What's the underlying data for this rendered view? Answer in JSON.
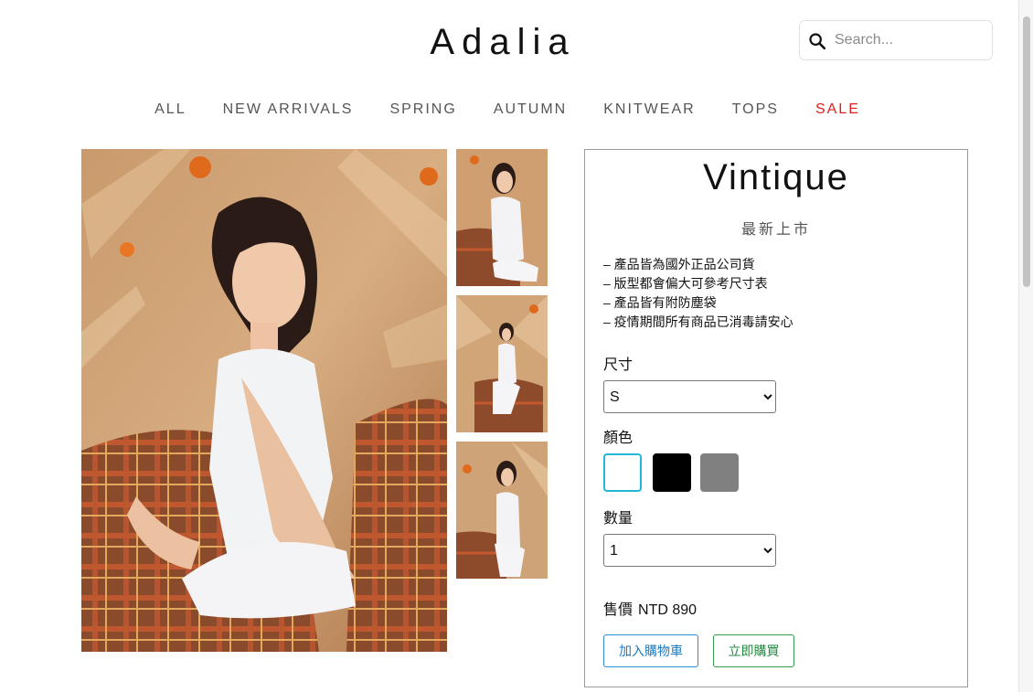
{
  "header": {
    "logo": "Adalia",
    "search": {
      "placeholder": "Search..."
    }
  },
  "nav": {
    "items": [
      "ALL",
      "NEW ARRIVALS",
      "SPRING",
      "AUTUMN",
      "KNITWEAR",
      "TOPS",
      "SALE"
    ],
    "highlight_color": "#e02020"
  },
  "product": {
    "brand": "Vintique",
    "subtitle": "最新上市",
    "features": [
      "– 產品皆為國外正品公司貨",
      "– 版型都會偏大可參考尺寸表",
      "– 產品皆有附防塵袋",
      "– 疫情期間所有商品已消毒請安心"
    ],
    "size": {
      "label": "尺寸",
      "selected": "S"
    },
    "color": {
      "label": "顏色",
      "swatches": [
        {
          "name": "white",
          "hex": "#ffffff",
          "selected": true
        },
        {
          "name": "black",
          "hex": "#000000",
          "selected": false
        },
        {
          "name": "gray",
          "hex": "#808080",
          "selected": false
        }
      ],
      "selected_border": "#22b7d8"
    },
    "quantity": {
      "label": "數量",
      "selected": "1"
    },
    "price": {
      "label": "售價",
      "value": "NTD 890"
    },
    "buttons": {
      "add_to_cart": "加入購物車",
      "buy_now": "立即購買"
    }
  }
}
